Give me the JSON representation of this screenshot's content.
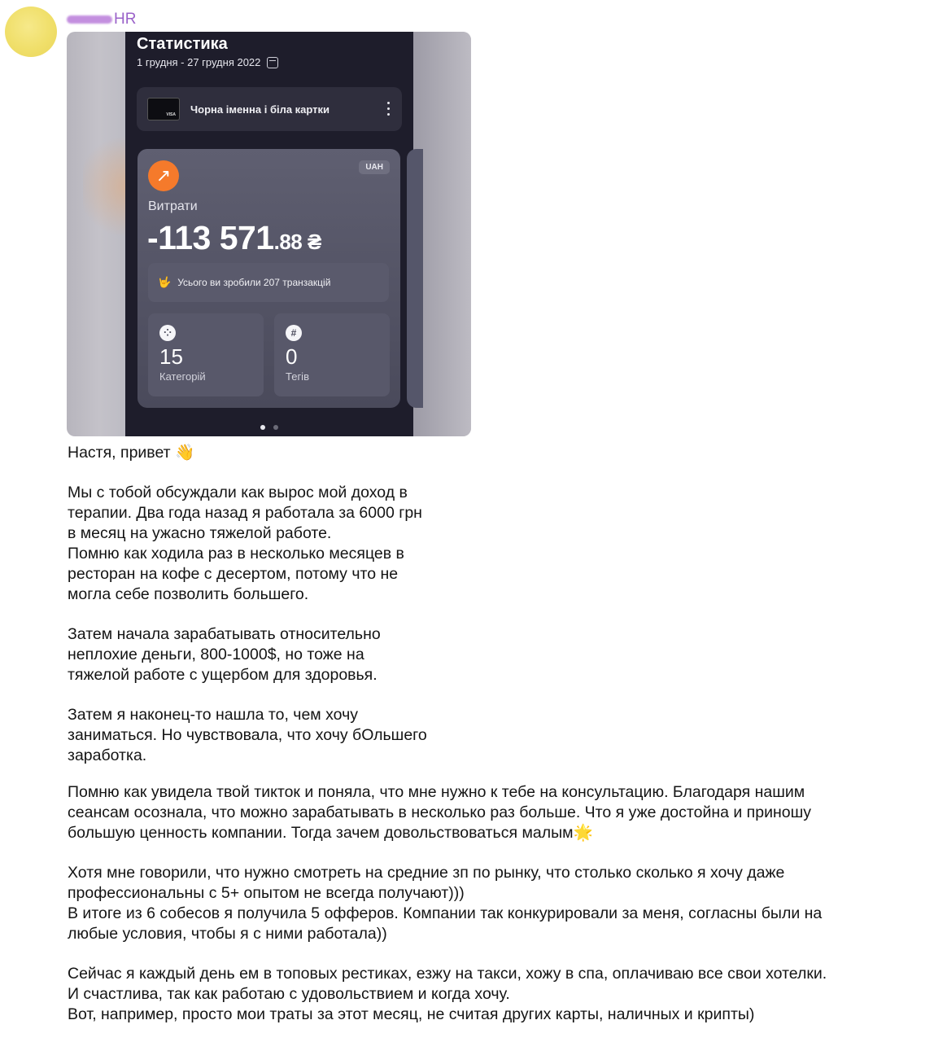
{
  "sender": {
    "name": "HR"
  },
  "screenshot": {
    "title": "Статистика",
    "date_range": "1 грудня - 27 грудня 2022",
    "card_name": "Чорна іменна і біла картки",
    "card_brand": "VISA",
    "currency": "UAH",
    "expenses_label": "Витрати",
    "amount_main": "-113 571",
    "amount_cents": ".88 ₴",
    "transactions_text": "Усього ви зробили 207 транзакцій",
    "categories_count": "15",
    "categories_label": "Категорій",
    "tags_count": "0",
    "tags_label": "Тегів",
    "accent_color": "#f57a2b"
  },
  "message": {
    "greeting": "Настя, привет 👋",
    "p1": [
      "Мы с тобой обсуждали как вырос мой доход в",
      "терапии. Два года назад я работала за 6000 грн",
      "в месяц на ужасно тяжелой работе.",
      "Помню как ходила раз в несколько месяцев в",
      "ресторан на кофе с десертом, потому что не",
      "могла себе позволить большего."
    ],
    "p2": [
      "Затем начала зарабатывать относительно",
      "неплохие деньги, 800-1000$, но тоже на",
      "тяжелой работе с ущербом для здоровья."
    ],
    "p3": [
      "Затем я наконец-то нашла то, чем хочу",
      "заниматься. Но чувствовала, что хочу бОльшего",
      "заработка."
    ],
    "p4": [
      "Помню как увидела твой тикток и поняла, что мне нужно к тебе на консультацию. Благодаря нашим",
      "сеансам осознала, что можно зарабатывать в несколько раз больше. Что я уже достойна и приношу",
      "большую ценность компании. Тогда зачем довольствоваться малым🌟"
    ],
    "p5": [
      "Хотя мне говорили, что нужно смотреть на средние зп по рынку, что столько сколько я хочу даже",
      "профессиональны с 5+ опытом не всегда получают)))",
      "В итоге из 6 собесов я получила 5 офферов. Компании так конкурировали за меня, согласны были на",
      "любые условия, чтобы я с ними работала))"
    ],
    "p6": [
      "Сейчас я каждый день ем в топовых рестиках, езжу на такси, хожу в спа, оплачиваю все свои хотелки.",
      "И счастлива, так как работаю с удовольствием и когда хочу.",
      "Вот, например, просто мои траты за этот месяц, не считая других карты, наличных и крипты)"
    ]
  }
}
